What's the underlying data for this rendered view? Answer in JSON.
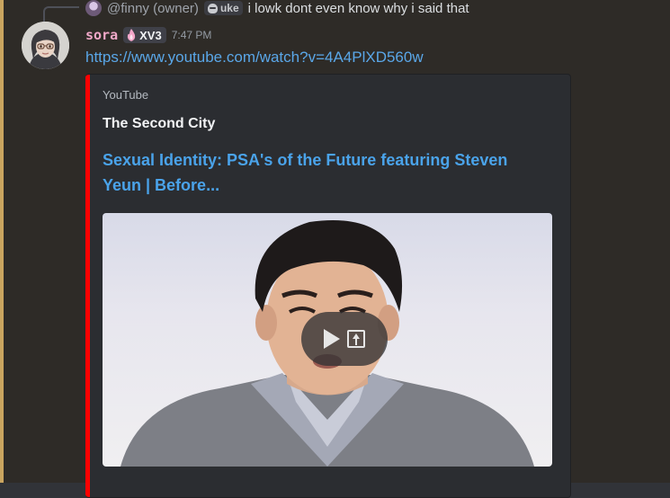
{
  "reply": {
    "author": "@finny (owner)",
    "tag": "uke",
    "text": "i lowk dont even know why i said that",
    "tag_icon": "skull-icon"
  },
  "message": {
    "username": "sora",
    "clan_tag": "XV3",
    "clan_icon": "flame-icon",
    "timestamp": "7:47 PM",
    "link": "https://www.youtube.com/watch?v=4A4PlXD560w"
  },
  "embed": {
    "provider": "YouTube",
    "author": "The Second City",
    "title": "Sexual Identity: PSA's of the Future featuring Steven Yeun | Before...",
    "accent_color": "#ff0000"
  },
  "colors": {
    "username": "#f0a8c8",
    "link": "#5aa7e8",
    "embed_title": "#4aa3ea",
    "mention_bar": "#c9a45f"
  }
}
